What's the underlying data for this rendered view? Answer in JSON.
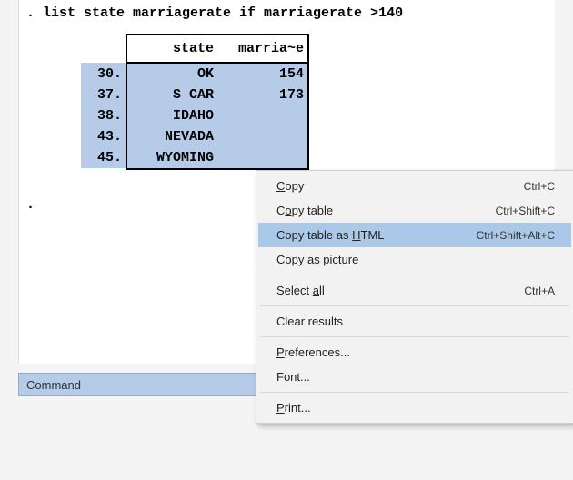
{
  "command_line": ". list state marriagerate if marriagerate >140",
  "table": {
    "idx_header": "",
    "col1_header": "state",
    "col2_header": "marria~e",
    "rows": [
      {
        "idx": "30.",
        "state": "OK",
        "val": "154"
      },
      {
        "idx": "37.",
        "state": "S CAR",
        "val": "173"
      },
      {
        "idx": "38.",
        "state": "IDAHO",
        "val": ""
      },
      {
        "idx": "43.",
        "state": "NEVADA",
        "val": ""
      },
      {
        "idx": "45.",
        "state": "WYOMING",
        "val": ""
      }
    ]
  },
  "prompt_dot": ".",
  "command_bar_label": "Command",
  "context_menu": {
    "copy": {
      "label_pre": "",
      "accel": "C",
      "label_post": "opy",
      "shortcut": "Ctrl+C"
    },
    "copy_table": {
      "label_pre": "C",
      "accel": "o",
      "label_post": "py table",
      "shortcut": "Ctrl+Shift+C"
    },
    "copy_table_html": {
      "label_pre": "Copy table as ",
      "accel": "H",
      "label_post": "TML",
      "shortcut": "Ctrl+Shift+Alt+C"
    },
    "copy_as_picture": {
      "label_pre": "Copy as picture",
      "accel": "",
      "label_post": "",
      "shortcut": ""
    },
    "select_all": {
      "label_pre": "Select ",
      "accel": "a",
      "label_post": "ll",
      "shortcut": "Ctrl+A"
    },
    "clear_results": {
      "label_pre": "Clear results",
      "accel": "",
      "label_post": "",
      "shortcut": ""
    },
    "preferences": {
      "label_pre": "",
      "accel": "P",
      "label_post": "references...",
      "shortcut": ""
    },
    "font": {
      "label_pre": "Font...",
      "accel": "",
      "label_post": "",
      "shortcut": ""
    },
    "print": {
      "label_pre": "",
      "accel": "P",
      "label_post": "rint...",
      "shortcut": ""
    }
  }
}
